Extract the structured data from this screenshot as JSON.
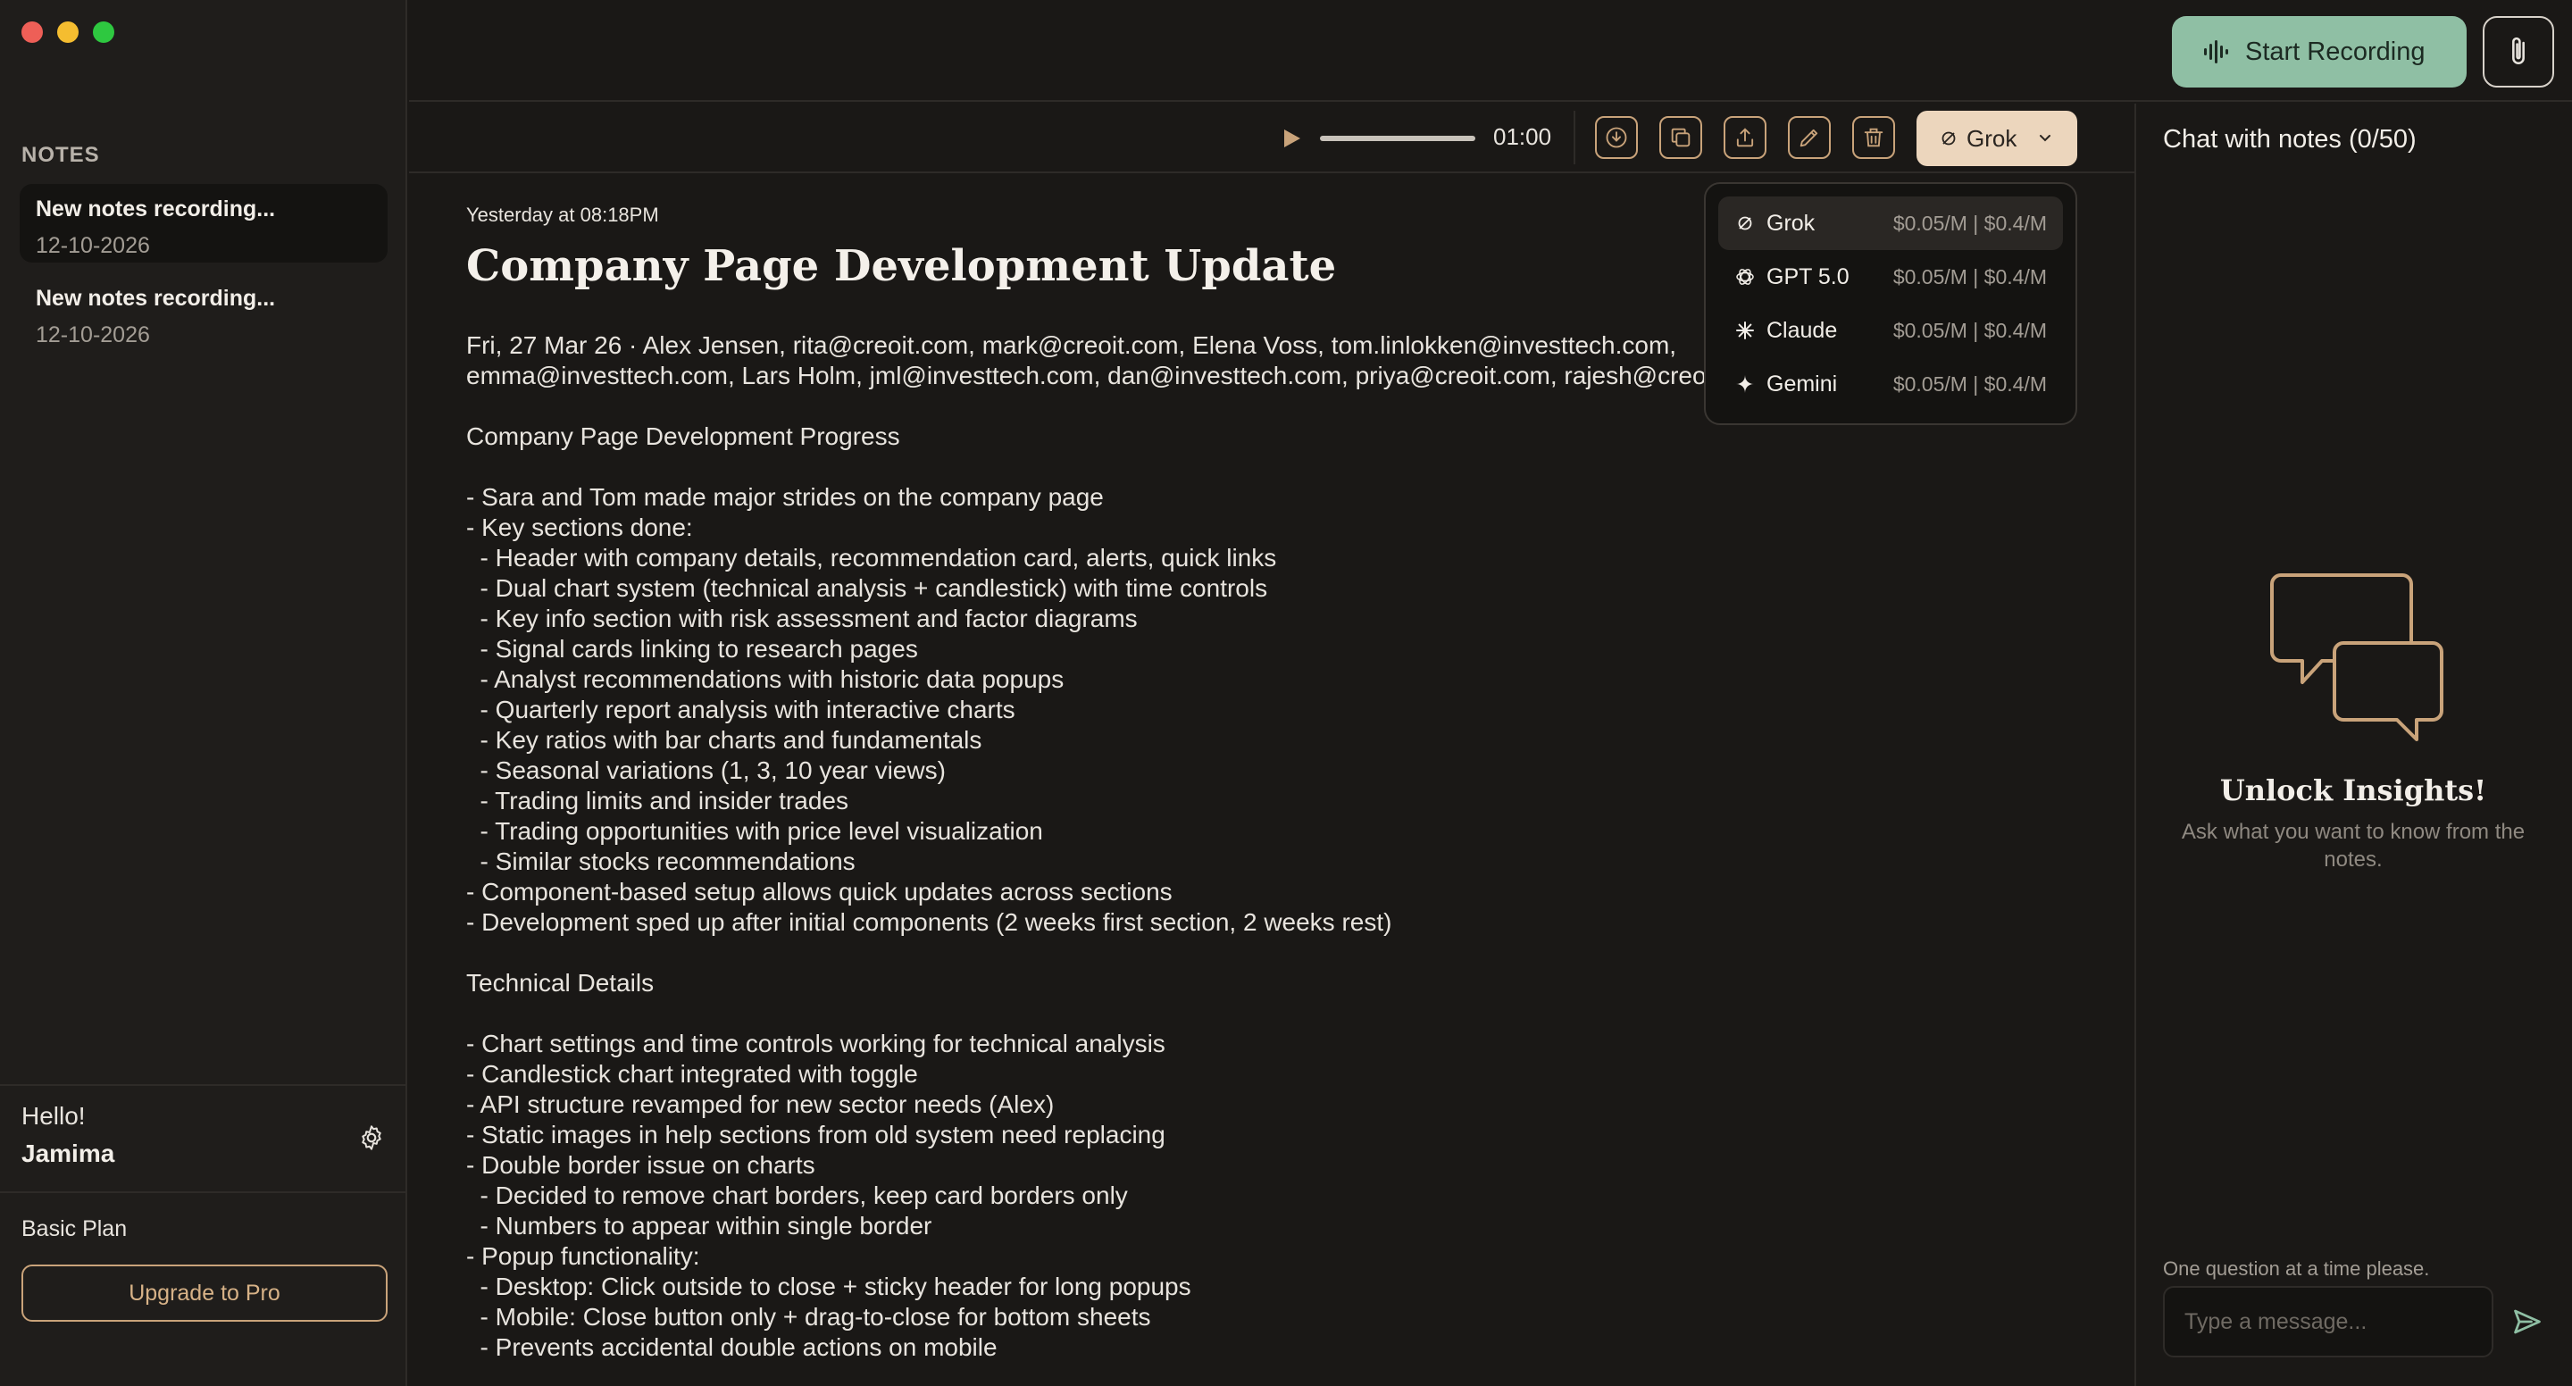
{
  "sidebar": {
    "notes_heading": "NOTES",
    "notes": [
      {
        "title": "New notes recording...",
        "date": "12-10-2026",
        "active": true
      },
      {
        "title": "New notes recording...",
        "date": "12-10-2026",
        "active": false
      }
    ],
    "greeting": "Hello!",
    "user_name": "Jamima",
    "plan": "Basic Plan",
    "upgrade_label": "Upgrade to Pro"
  },
  "header": {
    "record_label": "Start Recording"
  },
  "toolbar": {
    "time": "01:00",
    "model_selected": "Grok"
  },
  "model_menu": {
    "items": [
      {
        "name": "Grok",
        "price": "$0.05/M | $0.4/M"
      },
      {
        "name": "GPT 5.0",
        "price": "$0.05/M | $0.4/M"
      },
      {
        "name": "Claude",
        "price": "$0.05/M | $0.4/M"
      },
      {
        "name": "Gemini",
        "price": "$0.05/M | $0.4/M"
      }
    ]
  },
  "document": {
    "timestamp": "Yesterday at 08:18PM",
    "title": "Company Page Development Update",
    "meta_lines": [
      "Fri, 27 Mar 26 · Alex Jensen, rita@creoit.com, mark@creoit.com, Elena Voss, tom.linlokken@investtech.com,",
      "emma@investtech.com, Lars Holm, jml@investtech.com, dan@investtech.com, priya@creoit.com, rajesh@creoit.com"
    ],
    "body_lines": [
      "Company Page Development Progress",
      "",
      "- Sara and Tom made major strides on the company page",
      "- Key sections done:",
      "  - Header with company details, recommendation card, alerts, quick links",
      "  - Dual chart system (technical analysis + candlestick) with time controls",
      "  - Key info section with risk assessment and factor diagrams",
      "  - Signal cards linking to research pages",
      "  - Analyst recommendations with historic data popups",
      "  - Quarterly report analysis with interactive charts",
      "  - Key ratios with bar charts and fundamentals",
      "  - Seasonal variations (1, 3, 10 year views)",
      "  - Trading limits and insider trades",
      "  - Trading opportunities with price level visualization",
      "  - Similar stocks recommendations",
      "- Component-based setup allows quick updates across sections",
      "- Development sped up after initial components (2 weeks first section, 2 weeks rest)",
      "",
      "Technical Details",
      "",
      "- Chart settings and time controls working for technical analysis",
      "- Candlestick chart integrated with toggle",
      "- API structure revamped for new sector needs (Alex)",
      "- Static images in help sections from old system need replacing",
      "- Double border issue on charts",
      "  - Decided to remove chart borders, keep card borders only",
      "  - Numbers to appear within single border",
      "- Popup functionality:",
      "  - Desktop: Click outside to close + sticky header for long popups",
      "  - Mobile: Close button only + drag-to-close for bottom sheets",
      "  - Prevents accidental double actions on mobile"
    ]
  },
  "chat": {
    "title": "Chat with notes (0/50)",
    "empty_title": "Unlock Insights!",
    "empty_subtitle": "Ask what you want to know from the notes.",
    "hint": "One question at a time please.",
    "placeholder": "Type a message..."
  },
  "colors": {
    "background": "#1a1816",
    "accent_border": "#c9a37a",
    "record_button": "#8fbfa4",
    "model_button": "#ecd6bd"
  }
}
